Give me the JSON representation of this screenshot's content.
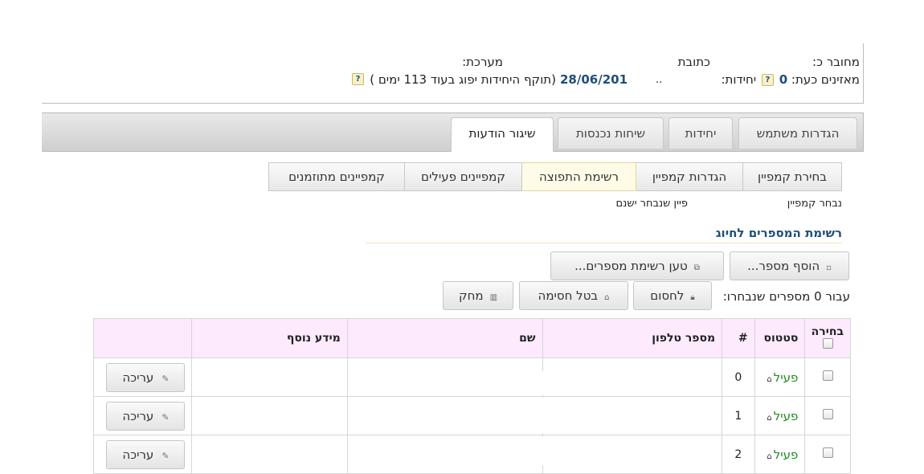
{
  "header": {
    "connected_label": "מחובר כ:",
    "address_label": "כתובת",
    "system_label": "מערכת:",
    "listeners_label": "מאזינים כעת:",
    "listeners_value": "0",
    "units_label": "יחידות:",
    "dots": "..",
    "expiry_date": "28/06/201",
    "expiry_text": "(תוקף היחידות יפוג בעוד 113 ימים )"
  },
  "tabs": [
    {
      "label": "הגדרות משתמש"
    },
    {
      "label": "יחידות"
    },
    {
      "label": "שיחות נכנסות"
    },
    {
      "label": "שיגור הודעות",
      "active": true
    }
  ],
  "subtabs": [
    {
      "label": "בחירת קמפיין"
    },
    {
      "label": "הגדרות קמפיין"
    },
    {
      "label": "רשימת התפוצה",
      "active": true
    },
    {
      "label": "קמפיינים פעילים"
    },
    {
      "label": "קמפיינים מתוזמנים"
    }
  ],
  "campaign": {
    "selected_label": "נבחר קמפיין",
    "selected_value": "פיין שנבחר ישנם"
  },
  "list_section": {
    "title": "רשימת המספרים לחיוג",
    "add_number": "הוסף מספר...",
    "load_list": "טען רשימת מספרים...",
    "selected_prefix": "עבור 0 מספרים שנבחרו:",
    "block": "לחסום",
    "unblock": "בטל חסימה",
    "delete": "מחק"
  },
  "table": {
    "headers": {
      "select": "בחירה",
      "status": "סטטוס",
      "index": "#",
      "phone": "מספר טלפון",
      "name": "שם",
      "info": "מידע נוסף"
    },
    "rows": [
      {
        "status": "פעיל",
        "index": "0",
        "phone": "",
        "name": "",
        "info": "",
        "edit": "עריכה"
      },
      {
        "status": "פעיל",
        "index": "1",
        "phone": "",
        "name": "",
        "info": "",
        "edit": "עריכה"
      },
      {
        "status": "פעיל",
        "index": "2",
        "phone": "",
        "name": "",
        "info": "",
        "edit": "עריכה"
      }
    ]
  },
  "colors": {
    "accent_title": "#1f4e79",
    "status_active": "#1f8a1f",
    "table_header_bg": "#fdeafd",
    "date_color": "#1f4e79"
  }
}
